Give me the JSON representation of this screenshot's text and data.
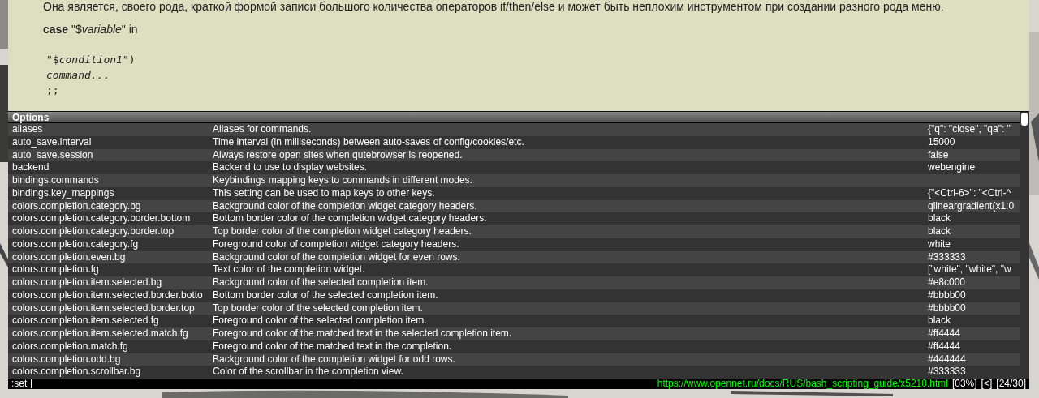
{
  "page": {
    "paragraph": "Она является, своего рода, краткой формой записи большого количества операторов if/then/else и может быть неплохим инструментом при создании разного рода меню.",
    "syntax": "**case** \"$*variable*\" in",
    "code": [
      "\"$*condition1*\")",
      "*command...*",
      ";;"
    ]
  },
  "completion": {
    "category": "Options",
    "rows": [
      {
        "name": "aliases",
        "description": "Aliases for commands.",
        "value": "{\"q\": \"close\", \"qa\": \""
      },
      {
        "name": "auto_save.interval",
        "description": "Time interval (in milliseconds) between auto-saves of config/cookies/etc.",
        "value": "15000"
      },
      {
        "name": "auto_save.session",
        "description": "Always restore open sites when qutebrowser is reopened.",
        "value": "false"
      },
      {
        "name": "backend",
        "description": "Backend to use to display websites.",
        "value": "webengine"
      },
      {
        "name": "bindings.commands",
        "description": "Keybindings mapping keys to commands in different modes."
      },
      {
        "name": "bindings.key_mappings",
        "description": "This setting can be used to map keys to other keys.",
        "value": "{\"<Ctrl-6>\": \"<Ctrl-^"
      },
      {
        "name": "colors.completion.category.bg",
        "description": "Background color of the completion widget category headers.",
        "value": "qlineargradient(x1:0"
      },
      {
        "name": "colors.completion.category.border.bottom",
        "description": "Bottom border color of the completion widget category headers.",
        "value": "black"
      },
      {
        "name": "colors.completion.category.border.top",
        "description": "Top border color of the completion widget category headers.",
        "value": "black"
      },
      {
        "name": "colors.completion.category.fg",
        "description": "Foreground color of completion widget category headers.",
        "value": "white"
      },
      {
        "name": "colors.completion.even.bg",
        "description": "Background color of the completion widget for even rows.",
        "value": "#333333"
      },
      {
        "name": "colors.completion.fg",
        "description": "Text color of the completion widget.",
        "value": "[\"white\", \"white\", \"w"
      },
      {
        "name": "colors.completion.item.selected.bg",
        "description": "Background color of the selected completion item.",
        "value": "#e8c000"
      },
      {
        "name": "colors.completion.item.selected.border.botto",
        "description": "Bottom border color of the selected completion item.",
        "value": "#bbbb00"
      },
      {
        "name": "colors.completion.item.selected.border.top",
        "description": "Top border color of the selected completion item.",
        "value": "#bbbb00"
      },
      {
        "name": "colors.completion.item.selected.fg",
        "description": "Foreground color of the selected completion item.",
        "value": "black"
      },
      {
        "name": "colors.completion.item.selected.match.fg",
        "description": "Foreground color of the matched text in the selected completion item.",
        "value": "#ff4444"
      },
      {
        "name": "colors.completion.match.fg",
        "description": "Foreground color of the matched text in the completion.",
        "value": "#ff4444"
      },
      {
        "name": "colors.completion.odd.bg",
        "description": "Background color of the completion widget for odd rows.",
        "value": "#444444"
      },
      {
        "name": "colors.completion.scrollbar.bg",
        "description": "Color of the scrollbar in the completion view.",
        "value": "#333333"
      }
    ]
  },
  "status_bar": {
    "command": ":set",
    "url": "https://www.opennet.ru/docs/RUS/bash_scripting_guide/x5210.html",
    "percent": "[03%]",
    "history": "[<]",
    "tabs": "[24/30]"
  }
}
